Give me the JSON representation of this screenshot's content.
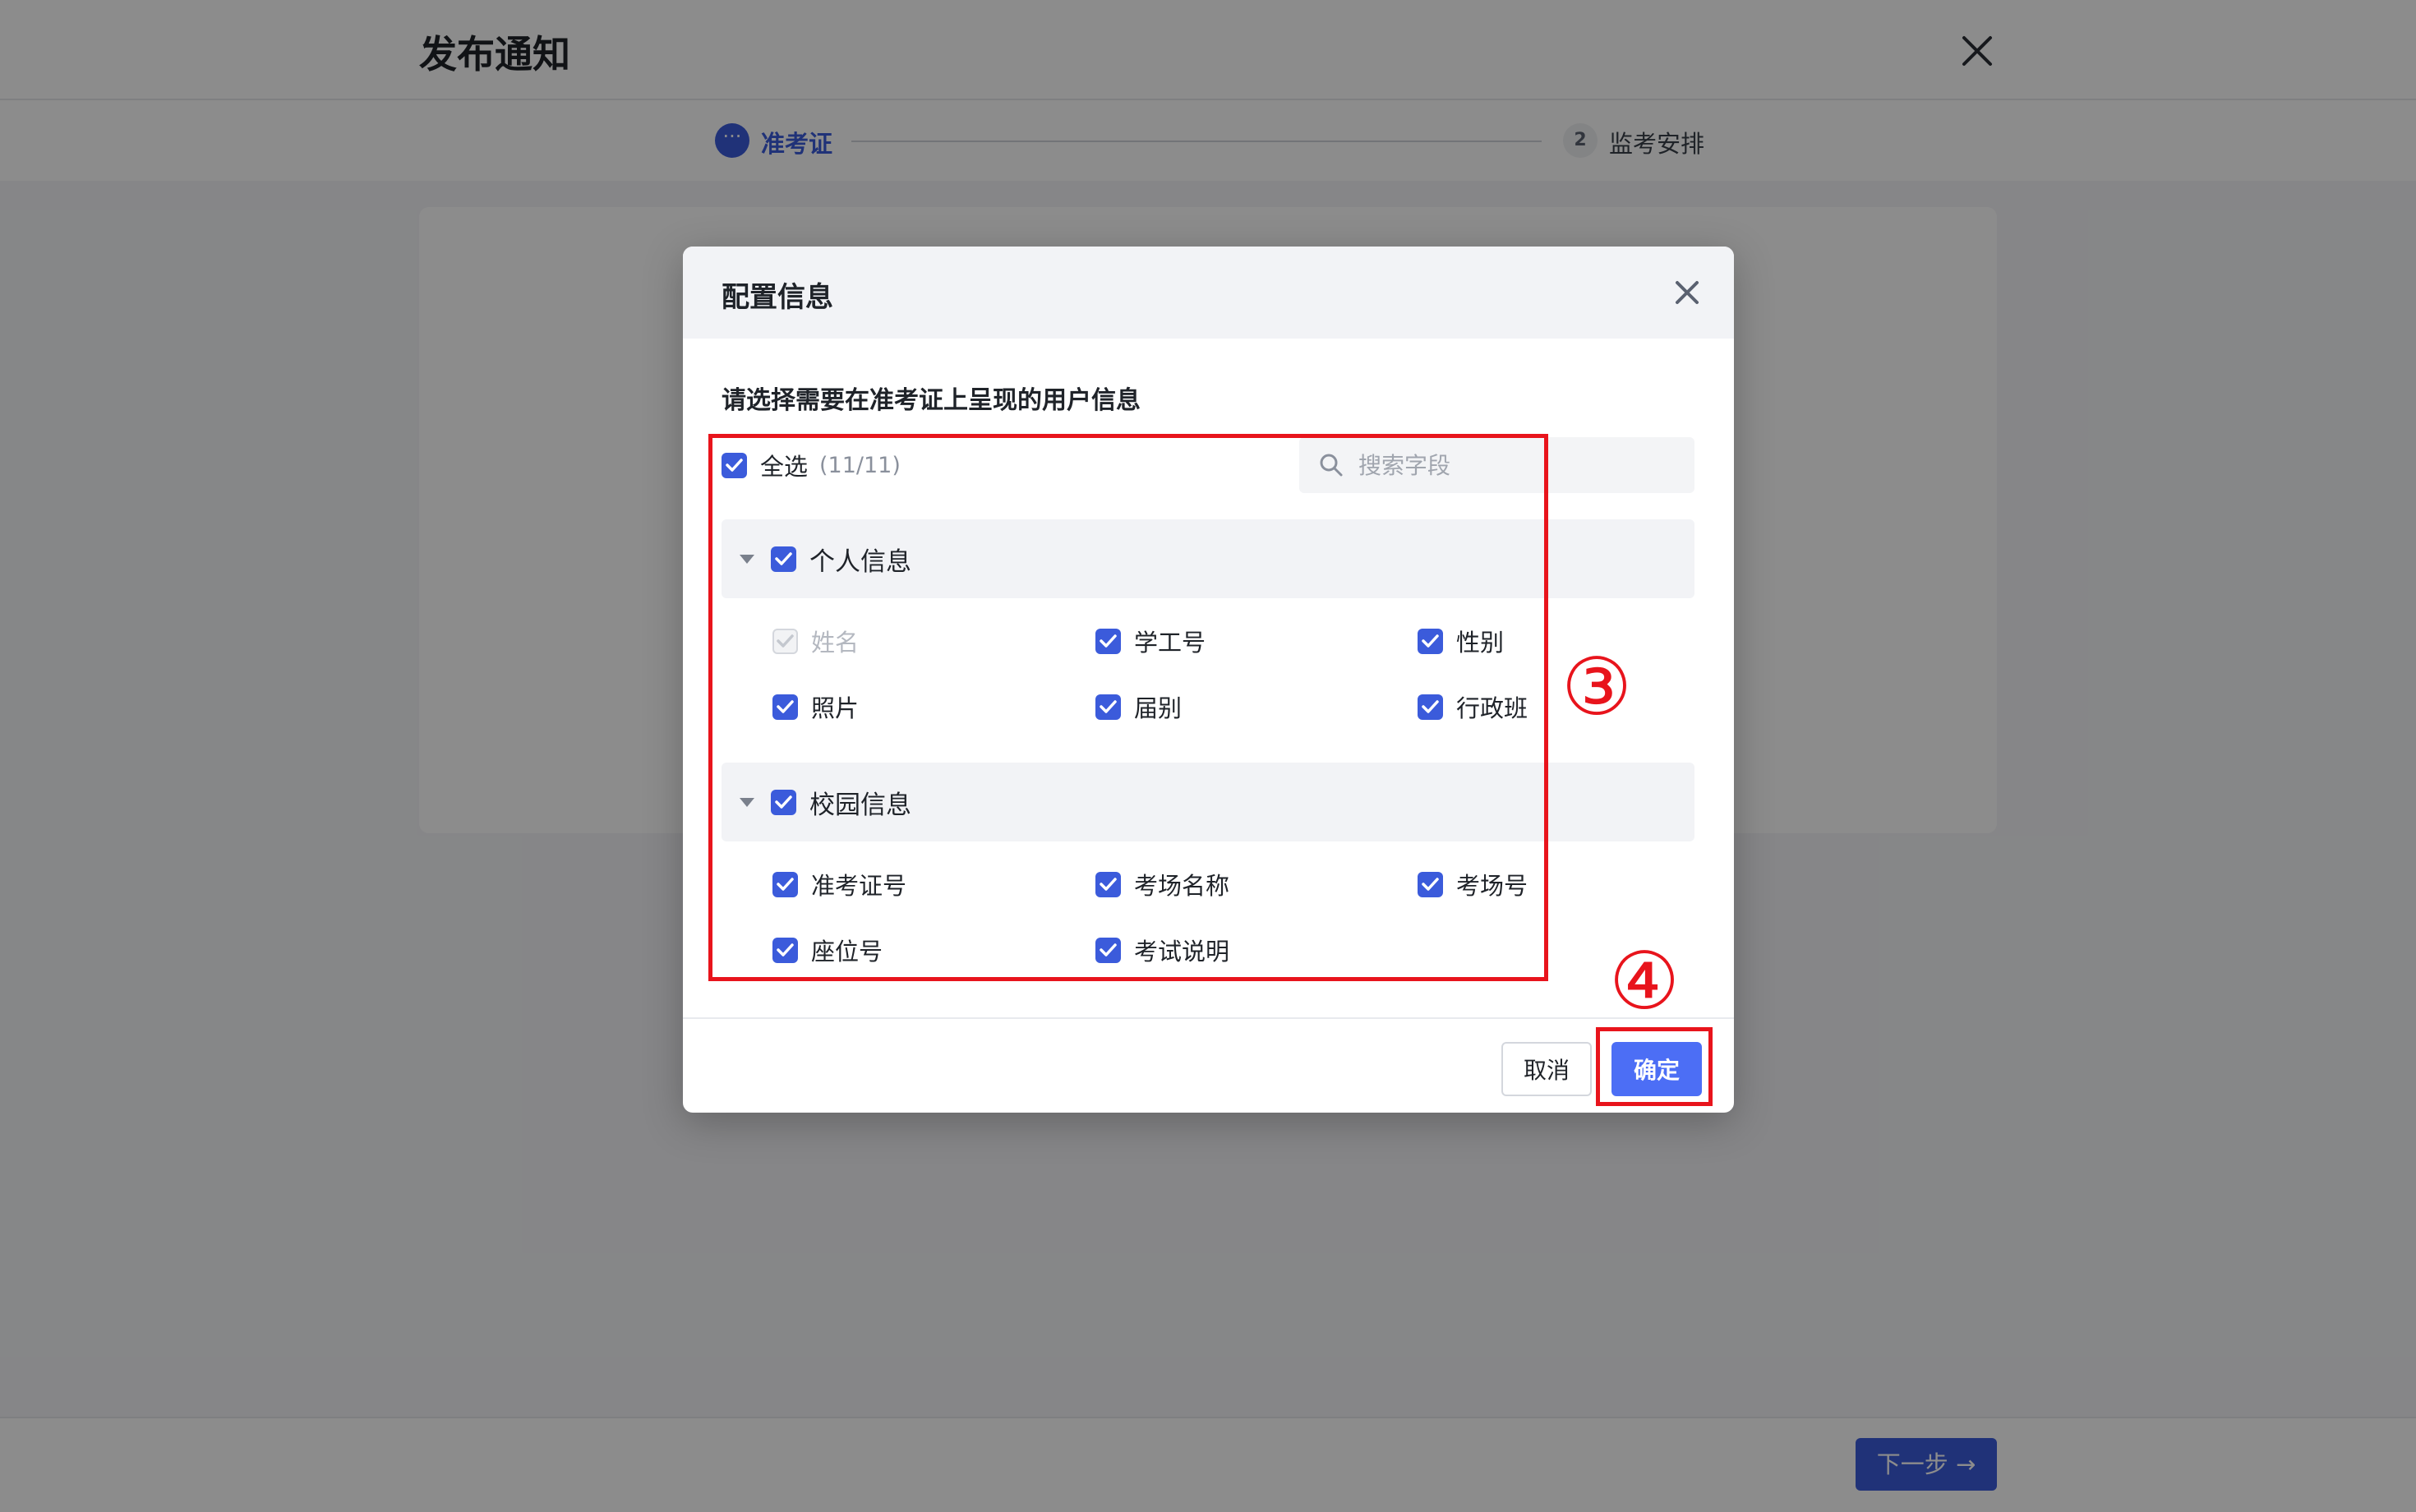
{
  "page": {
    "title": "发布通知",
    "steps": [
      {
        "index": "···",
        "label": "准考证",
        "active": true
      },
      {
        "index": "2",
        "label": "监考安排",
        "active": false
      }
    ],
    "next_label": "下一步 →"
  },
  "modal": {
    "title": "配置信息",
    "instruction": "请选择需要在准考证上呈现的用户信息",
    "select_all": {
      "label": "全选",
      "count": "(11/11)",
      "checked": true
    },
    "search": {
      "placeholder": "搜索字段"
    },
    "groups": [
      {
        "label": "个人信息",
        "checked": true,
        "fields": [
          {
            "label": "姓名",
            "checked": true,
            "disabled": true
          },
          {
            "label": "学工号",
            "checked": true
          },
          {
            "label": "性别",
            "checked": true
          },
          {
            "label": "照片",
            "checked": true
          },
          {
            "label": "届别",
            "checked": true
          },
          {
            "label": "行政班",
            "checked": true
          }
        ]
      },
      {
        "label": "校园信息",
        "checked": true,
        "fields": [
          {
            "label": "准考证号",
            "checked": true
          },
          {
            "label": "考场名称",
            "checked": true
          },
          {
            "label": "考场号",
            "checked": true
          },
          {
            "label": "座位号",
            "checked": true
          },
          {
            "label": "考试说明",
            "checked": true
          }
        ]
      }
    ],
    "cancel_label": "取消",
    "confirm_label": "确定"
  },
  "annotations": {
    "marker_3": "③",
    "marker_4": "④",
    "color": "#e8141c"
  },
  "colors": {
    "primary": "#3b5bdb",
    "confirm": "#4c6ef5"
  }
}
